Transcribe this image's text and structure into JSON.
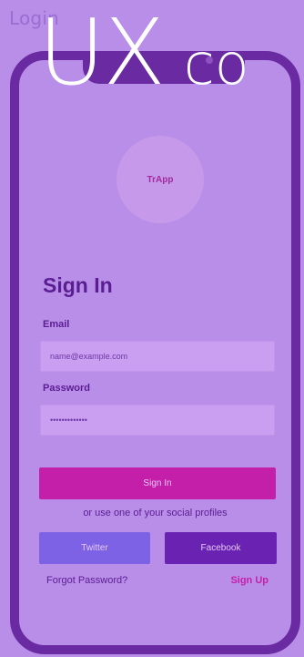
{
  "page": {
    "title": "Login",
    "overlay_big": "UX",
    "overlay_small": "co"
  },
  "app": {
    "logo_text": "TrApp"
  },
  "form": {
    "heading": "Sign In",
    "email_label": "Email",
    "email_placeholder": "name@example.com",
    "password_label": "Password",
    "password_value": "•••••••••••••",
    "signin_label": "Sign In",
    "social_text": "or use one of your social profiles",
    "twitter_label": "Twitter",
    "facebook_label": "Facebook",
    "forgot_label": "Forgot Password?",
    "signup_label": "Sign Up"
  },
  "colors": {
    "background": "#b98ee9",
    "phone_frame": "#6a2aa1",
    "primary": "#c41fa9",
    "twitter": "#7d62e6",
    "facebook": "#6a22b2",
    "text": "#5b1d92"
  }
}
